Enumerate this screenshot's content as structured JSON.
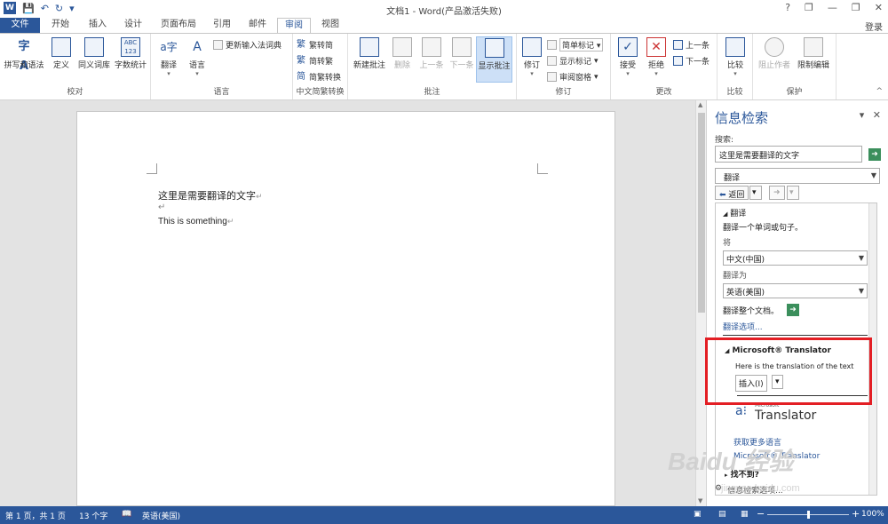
{
  "window": {
    "title": "文档1 - Word(产品激活失败)",
    "login": "登录",
    "controls": [
      "?",
      "❐",
      "—",
      "❐",
      "✕"
    ]
  },
  "tabs": [
    {
      "label": "文件"
    },
    {
      "label": "开始"
    },
    {
      "label": "插入"
    },
    {
      "label": "设计"
    },
    {
      "label": "页面布局"
    },
    {
      "label": "引用"
    },
    {
      "label": "邮件"
    },
    {
      "label": "审阅"
    },
    {
      "label": "视图"
    }
  ],
  "ribbon": {
    "proofing": {
      "label": "校对",
      "spell": "拼写和语法",
      "define": "定义",
      "thesaurus": "同义词库",
      "wordcount": "字数统计"
    },
    "language": {
      "label": "语言",
      "translate": "翻译",
      "language": "语言",
      "update_ime": "更新输入法词典"
    },
    "chinese": {
      "label": "中文简繁转换",
      "to_simple": "繁转简",
      "to_trad": "简转繁",
      "convert": "简繁转换"
    },
    "comments": {
      "label": "批注",
      "new": "新建批注",
      "delete": "删除",
      "prev": "上一条",
      "next": "下一条",
      "show": "显示批注"
    },
    "tracking": {
      "label": "修订",
      "track": "修订",
      "markup": "简单标记",
      "show_markup": "显示标记",
      "pane": "审阅窗格"
    },
    "changes": {
      "label": "更改",
      "accept": "接受",
      "reject": "拒绝",
      "prev": "上一条",
      "next": "下一条"
    },
    "compare": {
      "label": "比较",
      "compare": "比较"
    },
    "protect": {
      "label": "保护",
      "block": "阻止作者",
      "restrict": "限制编辑"
    }
  },
  "document": {
    "line1": "这里是需要翻译的文字",
    "line2": "This is something",
    "para_mark": "↵"
  },
  "research_pane": {
    "title": "信息检索",
    "search_label": "搜索:",
    "search_value": "这里是需要翻译的文字",
    "service": "翻译",
    "back": "返回",
    "section_title": "翻译",
    "instruction": "翻译一个单词或句子。",
    "from_label": "将",
    "from_value": "中文(中国)",
    "to_label": "翻译为",
    "to_value": "英语(美国)",
    "translate_doc": "翻译整个文档。",
    "options_link": "翻译选项...",
    "ms_title": "Microsoft® Translator",
    "result": "Here is the translation of the text",
    "insert": "插入(I)",
    "logo_small": "Microsoft",
    "logo_big": "Translator",
    "link1": "获取更多语言",
    "link2": "Microsoft® Translator",
    "not_found": "找不到?",
    "footer": "信息检索选项..."
  },
  "status": {
    "page": "第 1 页，共 1 页",
    "words": "13 个字",
    "lang": "英语(美国)",
    "zoom": "100%"
  },
  "watermark": {
    "big": "Baidu 经验",
    "small": "jingyan.baidu.com"
  }
}
